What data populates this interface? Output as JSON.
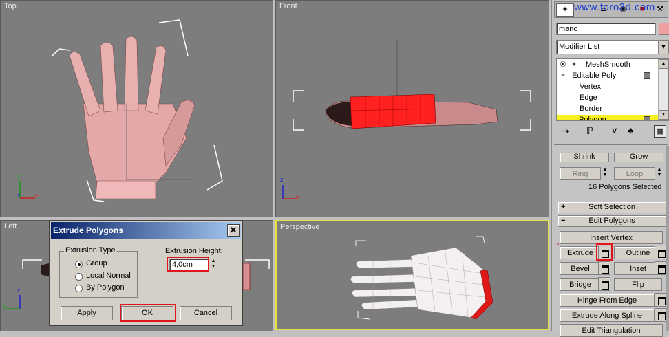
{
  "viewports": {
    "top": "Top",
    "front": "Front",
    "left": "Left",
    "perspective": "Perspective"
  },
  "watermark": "www.foro3d.com",
  "command_panel": {
    "object_name": "mano",
    "modifier_list": "Modifier List",
    "stack": [
      {
        "label": "MeshSmooth",
        "prefix": "+"
      },
      {
        "label": "Editable Poly",
        "prefix": "−"
      },
      {
        "label": "Vertex"
      },
      {
        "label": "Edge"
      },
      {
        "label": "Border"
      },
      {
        "label": "Polygon"
      }
    ],
    "selection": {
      "shrink": "Shrink",
      "grow": "Grow",
      "ring": "Ring",
      "loop": "Loop",
      "status": "16 Polygons Selected"
    },
    "soft_selection": "Soft Selection",
    "edit_polygons": "Edit Polygons",
    "buttons": {
      "insert_vertex": "Insert Vertex",
      "extrude": "Extrude",
      "outline": "Outline",
      "bevel": "Bevel",
      "inset": "Inset",
      "bridge": "Bridge",
      "flip": "Flip",
      "hinge": "Hinge From Edge",
      "extrude_spline": "Extrude Along Spline",
      "edit_triangulation": "Edit Triangulation"
    }
  },
  "dialog": {
    "title": "Extrude Polygons",
    "extrusion_type_label": "Extrusion Type",
    "options": [
      "Group",
      "Local Normal",
      "By Polygon"
    ],
    "selected_option": "Group",
    "height_label": "Extrusion Height:",
    "height_value": "4,0cm",
    "apply": "Apply",
    "ok": "OK",
    "cancel": "Cancel"
  },
  "axes": {
    "x": "x",
    "y": "y",
    "z": "z"
  },
  "colors": {
    "selection_red": "#ff2020",
    "active_viewport": "#e8e040",
    "highlight": "#e0141c"
  }
}
